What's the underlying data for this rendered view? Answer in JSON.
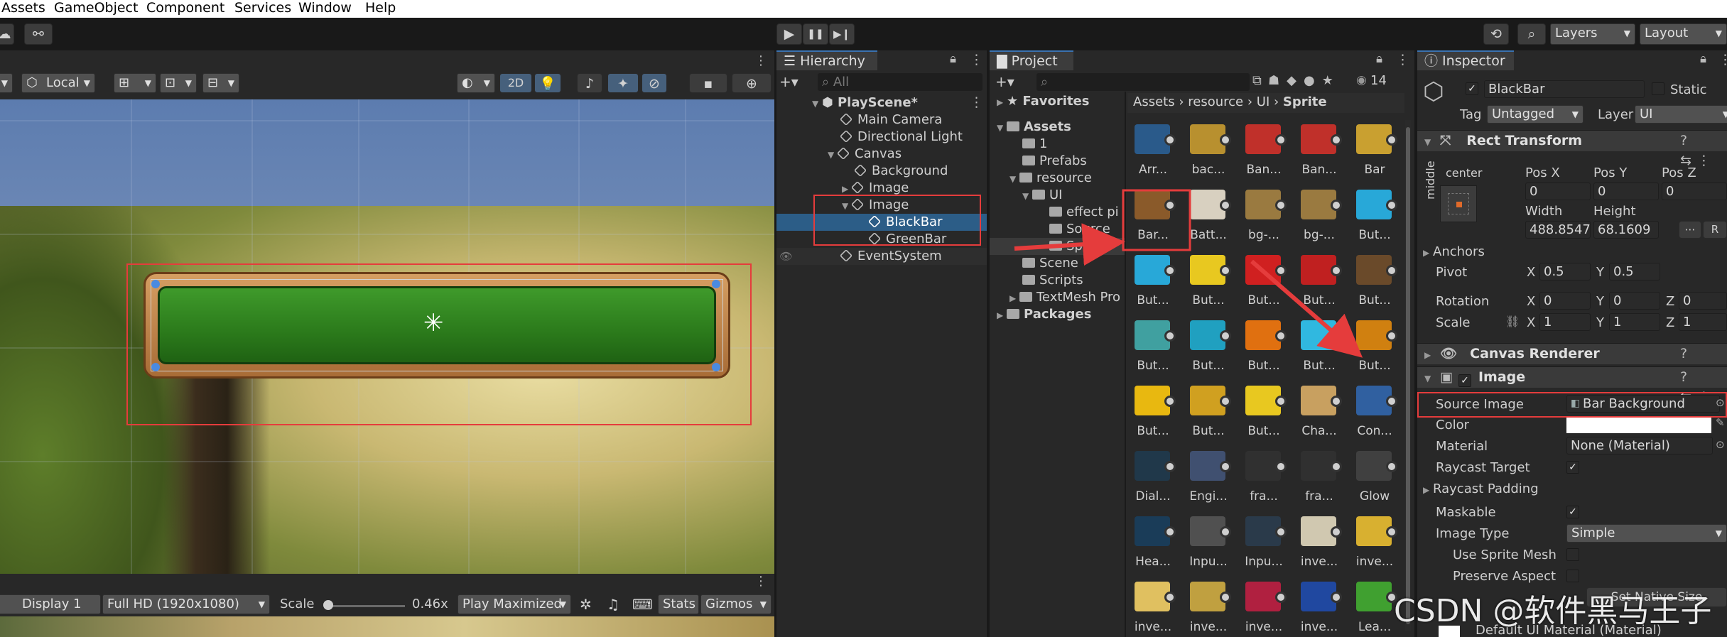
{
  "menu": [
    "Assets",
    "GameObject",
    "Component",
    "Services",
    "Window",
    "Help"
  ],
  "toolbar": {
    "play": "▶",
    "pause": "❚❚",
    "step": "▶❙",
    "layers": "Layers",
    "layout": "Layout"
  },
  "scene": {
    "local_label": "Local",
    "mode_2d": "2D",
    "game_bar": {
      "display": "Display 1",
      "resolution": "Full HD (1920x1080)",
      "scale_label": "Scale",
      "scale_value": "0.46x",
      "play_mode": "Play Maximized",
      "stats": "Stats",
      "gizmos": "Gizmos"
    }
  },
  "hierarchy": {
    "tab": "Hierarchy",
    "search_placeholder": "All",
    "items": [
      {
        "label": "PlayScene*",
        "bold": true
      },
      {
        "label": "Main Camera"
      },
      {
        "label": "Directional Light"
      },
      {
        "label": "Canvas"
      },
      {
        "label": "Background"
      },
      {
        "label": "Image"
      },
      {
        "label": "Image"
      },
      {
        "label": "BlackBar",
        "selected": true
      },
      {
        "label": "GreenBar"
      },
      {
        "label": "EventSystem"
      }
    ]
  },
  "project": {
    "tab": "Project",
    "count": "14",
    "tree": [
      {
        "label": "Favorites",
        "bold": true
      },
      {
        "label": "Assets",
        "bold": true
      },
      {
        "label": "1"
      },
      {
        "label": "Prefabs"
      },
      {
        "label": "resource"
      },
      {
        "label": "UI"
      },
      {
        "label": "effect pi"
      },
      {
        "label": "Source"
      },
      {
        "label": "Sprite"
      },
      {
        "label": "Scene"
      },
      {
        "label": "Scripts"
      },
      {
        "label": "TextMesh Pro"
      },
      {
        "label": "Packages",
        "bold": true
      }
    ],
    "breadcrumb": [
      "Assets",
      "resource",
      "UI",
      "Sprite"
    ],
    "assets": [
      "Arr...",
      "bac...",
      "Ban...",
      "Ban...",
      "Bar",
      "Bar...",
      "Batt...",
      "bg-...",
      "bg-...",
      "But...",
      "But...",
      "But...",
      "But...",
      "But...",
      "But...",
      "But...",
      "But...",
      "But...",
      "But...",
      "But...",
      "But...",
      "But...",
      "But...",
      "Cha...",
      "Con...",
      "Dial...",
      "Engi...",
      "fra...",
      "fra...",
      "Glow",
      "Hea...",
      "Inpu...",
      "Inpu...",
      "inve...",
      "inve...",
      "inve...",
      "inve...",
      "inve...",
      "inve...",
      "Lea..."
    ]
  },
  "inspector": {
    "tab": "Inspector",
    "name": "BlackBar",
    "static_label": "Static",
    "tag_label": "Tag",
    "tag_value": "Untagged",
    "layer_label": "Layer",
    "layer_value": "UI",
    "rect_transform": {
      "title": "Rect Transform",
      "anchor_h": "center",
      "anchor_v": "middle",
      "posx_label": "Pos X",
      "posy_label": "Pos Y",
      "posz_label": "Pos Z",
      "posx": "0",
      "posy": "0",
      "posz": "0",
      "width_label": "Width",
      "height_label": "Height",
      "width": "488.8547",
      "height": "68.1609",
      "anchors": "Anchors",
      "pivot": "Pivot",
      "pivot_x": "0.5",
      "pivot_y": "0.5",
      "rotation": "Rotation",
      "rot_x": "0",
      "rot_y": "0",
      "rot_z": "0",
      "scale": "Scale",
      "scale_x": "1",
      "scale_y": "1",
      "scale_z": "1",
      "x": "X",
      "y": "Y",
      "z": "Z",
      "r": "R"
    },
    "canvas_renderer": "Canvas Renderer",
    "image": {
      "title": "Image",
      "source_image_label": "Source Image",
      "source_image_value": "Bar Background",
      "color_label": "Color",
      "material_label": "Material",
      "material_value": "None (Material)",
      "raycast_target": "Raycast Target",
      "raycast_padding": "Raycast Padding",
      "maskable": "Maskable",
      "image_type_label": "Image Type",
      "image_type_value": "Simple",
      "use_sprite_mesh": "Use Sprite Mesh",
      "preserve_aspect": "Preserve Aspect",
      "set_native_size": "Set Native Size",
      "default_material": "Default UI Material (Material)"
    }
  },
  "watermark": "CSDN @软件黑马王子",
  "colors": {
    "accent": "#3a72b0",
    "selection": "#2c5d87",
    "annotation": "#e53c3c"
  }
}
